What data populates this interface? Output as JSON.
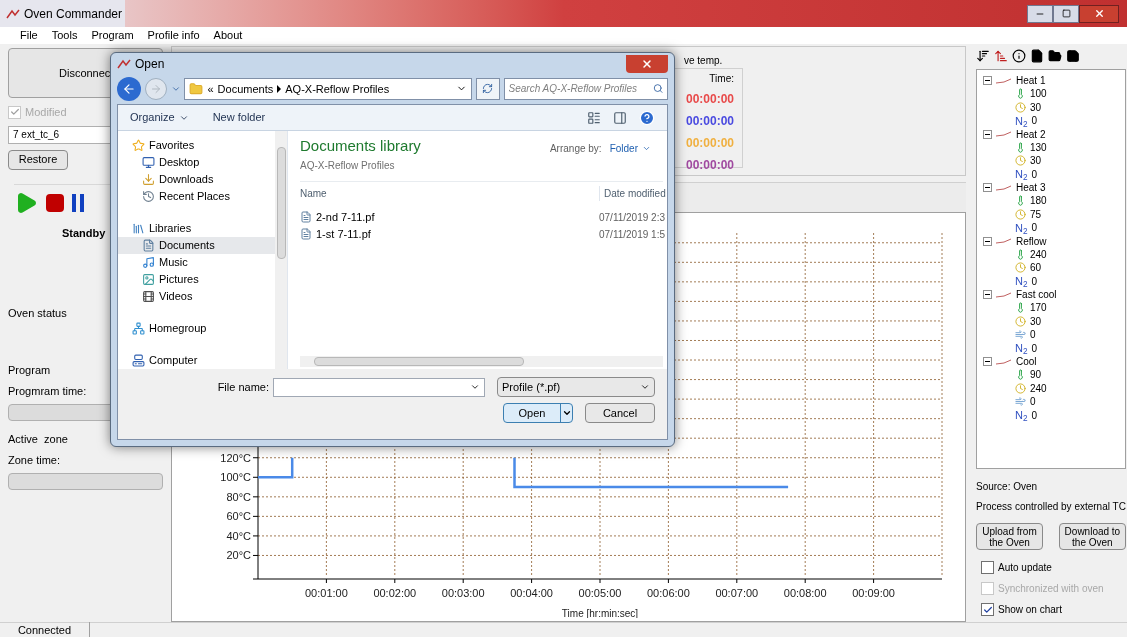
{
  "window": {
    "title": "Oven Commander"
  },
  "menu": [
    "File",
    "Tools",
    "Program",
    "Profile info",
    "About"
  ],
  "left_panel": {
    "connect_button": "Disconnec",
    "modified": {
      "label": "Modified",
      "checked": true,
      "disabled": true
    },
    "profile_name": "7 ext_tc_6",
    "restore_button": "Restore",
    "state": "Standby",
    "oven_status_label": "Oven status",
    "program_label": "Program",
    "program_time_label": "Progmram time:",
    "program_progress": {
      "level": 0
    },
    "active_zone_label": "Active  zone",
    "zone_time_label": "Zone time:",
    "zone_progress": {
      "level": 0
    }
  },
  "timers": {
    "title": "ve temp.",
    "header": "Time:",
    "rows": [
      {
        "text": "00:00:00",
        "color": "#e84a4a"
      },
      {
        "text": "00:00:00",
        "color": "#4a4ae0"
      },
      {
        "text": "00:00:00",
        "color": "#f0b040"
      },
      {
        "text": "00:00:00",
        "color": "#a04aa0"
      }
    ]
  },
  "chart": {
    "chart_data": {
      "type": "line",
      "grid": true,
      "xlabel": "Time [hr:min:sec]",
      "xlim": [
        0,
        600
      ],
      "ylim": [
        0,
        350
      ],
      "xticks": [
        {
          "value": 60,
          "label": "00:01:00"
        },
        {
          "value": 120,
          "label": "00:02:00"
        },
        {
          "value": 180,
          "label": "00:03:00"
        },
        {
          "value": 240,
          "label": "00:04:00"
        },
        {
          "value": 300,
          "label": "00:05:00"
        },
        {
          "value": 360,
          "label": "00:06:00"
        },
        {
          "value": 420,
          "label": "00:07:00"
        },
        {
          "value": 480,
          "label": "00:08:00"
        },
        {
          "value": 540,
          "label": "00:09:00"
        }
      ],
      "yticks": [
        {
          "value": 20,
          "label": "20°C"
        },
        {
          "value": 40,
          "label": "40°C"
        },
        {
          "value": 60,
          "label": "60°C"
        },
        {
          "value": 80,
          "label": "80°C"
        },
        {
          "value": 100,
          "label": "100°C"
        },
        {
          "value": 120,
          "label": "120°C"
        }
      ],
      "x": [
        0,
        30,
        30,
        225,
        225,
        465
      ],
      "series": [
        {
          "color": "#4a8ae8",
          "values": [
            100,
            100,
            120,
            null,
            null,
            null
          ]
        },
        {
          "color": "#4a8ae8",
          "values": [
            null,
            null,
            null,
            120,
            90,
            90
          ]
        }
      ]
    }
  },
  "profile_tree": [
    {
      "name": "Heat 1",
      "expanded": true,
      "children": [
        {
          "kind": "temp",
          "value": "100"
        },
        {
          "kind": "time",
          "value": "30"
        },
        {
          "kind": "gas",
          "symbol": "N$_{2}$",
          "value": "0"
        }
      ]
    },
    {
      "name": "Heat 2",
      "expanded": true,
      "children": [
        {
          "kind": "temp",
          "value": "130"
        },
        {
          "kind": "time",
          "value": "30"
        },
        {
          "kind": "gas",
          "symbol": "N$_{2}$",
          "value": "0"
        }
      ]
    },
    {
      "name": "Heat 3",
      "expanded": true,
      "children": [
        {
          "kind": "temp",
          "value": "180"
        },
        {
          "kind": "time",
          "value": "75"
        },
        {
          "kind": "gas",
          "symbol": "N$_{2}$",
          "value": "0"
        }
      ]
    },
    {
      "name": "Reflow",
      "expanded": true,
      "children": [
        {
          "kind": "temp",
          "value": "240"
        },
        {
          "kind": "time",
          "value": "60"
        },
        {
          "kind": "gas",
          "symbol": "N$_{2}$",
          "value": "0"
        }
      ]
    },
    {
      "name": "Fast cool",
      "expanded": true,
      "children": [
        {
          "kind": "temp",
          "value": "170"
        },
        {
          "kind": "time",
          "value": "30"
        },
        {
          "kind": "fan",
          "value": "0"
        },
        {
          "kind": "gas",
          "symbol": "N$_{2}$",
          "value": "0"
        }
      ]
    },
    {
      "name": "Cool",
      "expanded": true,
      "children": [
        {
          "kind": "temp",
          "value": "90"
        },
        {
          "kind": "time",
          "value": "240"
        },
        {
          "kind": "fan",
          "value": "0"
        },
        {
          "kind": "gas",
          "symbol": "N$_{2}$",
          "value": "0"
        }
      ]
    }
  ],
  "right_panel": {
    "source": "Source: Oven",
    "process": "Process controlled by external TC",
    "buttons": [
      "Upload from the Oven",
      "Download to the Oven"
    ],
    "options": [
      {
        "label": "Auto update",
        "checked": false,
        "disabled": false
      },
      {
        "label": "Synchronized with oven",
        "checked": false,
        "disabled": true
      },
      {
        "label": "Show on chart",
        "checked": true,
        "disabled": false
      }
    ]
  },
  "status_bar": "Connected",
  "dialog": {
    "title": "Open",
    "breadcrumb": [
      "«",
      "Documents",
      "AQ-X-Reflow Profiles"
    ],
    "search": {
      "placeholder": "Search AQ-X-Reflow Profiles"
    },
    "toolbar": [
      "Organize",
      "New folder"
    ],
    "nav": [
      {
        "label": "Favorites",
        "kind": "star",
        "group": true,
        "selected": false
      },
      {
        "label": "Desktop",
        "kind": "desktop",
        "group": false,
        "selected": false
      },
      {
        "label": "Downloads",
        "kind": "downloads",
        "group": false,
        "selected": false
      },
      {
        "label": "Recent Places",
        "kind": "recent",
        "group": false,
        "selected": false
      },
      {
        "label": "Libraries",
        "kind": "libraries",
        "group": true,
        "selected": false
      },
      {
        "label": "Documents",
        "kind": "documents",
        "group": false,
        "selected": true
      },
      {
        "label": "Music",
        "kind": "music",
        "group": false,
        "selected": false
      },
      {
        "label": "Pictures",
        "kind": "pictures",
        "group": false,
        "selected": false
      },
      {
        "label": "Videos",
        "kind": "videos",
        "group": false,
        "selected": false
      },
      {
        "label": "Homegroup",
        "kind": "homegroup",
        "group": true,
        "selected": false
      },
      {
        "label": "Computer",
        "kind": "computer",
        "group": true,
        "selected": false
      }
    ],
    "library_title": "Documents library",
    "library_subtitle": "AQ-X-Reflow Profiles",
    "arrange_label": "Arrange by:",
    "arrange_value": "Folder",
    "columns": [
      "Name",
      "Date modified"
    ],
    "files": [
      {
        "name": "2-nd 7-11.pf",
        "date": "07/11/2019 2:3"
      },
      {
        "name": "1-st 7-11.pf",
        "date": "07/11/2019 1:5"
      }
    ],
    "file_name_label": "File name:",
    "filter": "Profile (*.pf)",
    "open_button": "Open",
    "cancel_button": "Cancel"
  }
}
